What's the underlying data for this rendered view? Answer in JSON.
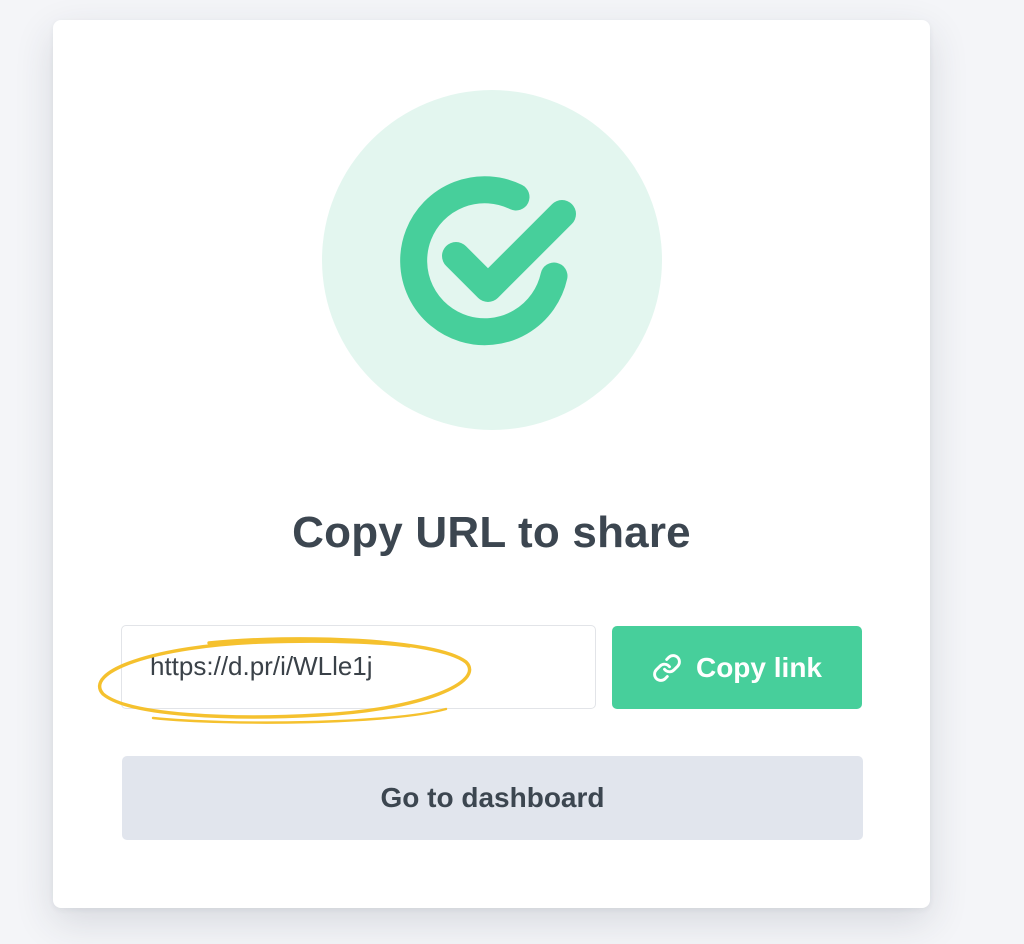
{
  "share_dialog": {
    "title": "Copy URL to share",
    "url_value": "https://d.pr/i/WLle1j",
    "copy_button_label": "Copy link",
    "dashboard_button_label": "Go to dashboard"
  },
  "icons": {
    "status": "check-circle-icon",
    "copy": "link-icon"
  },
  "colors": {
    "accent_green": "#47cf9b",
    "badge_background": "#e3f6ef",
    "title_text": "#3c4650",
    "secondary_button": "#e1e5ed",
    "highlight_outline": "#f5c12e"
  }
}
